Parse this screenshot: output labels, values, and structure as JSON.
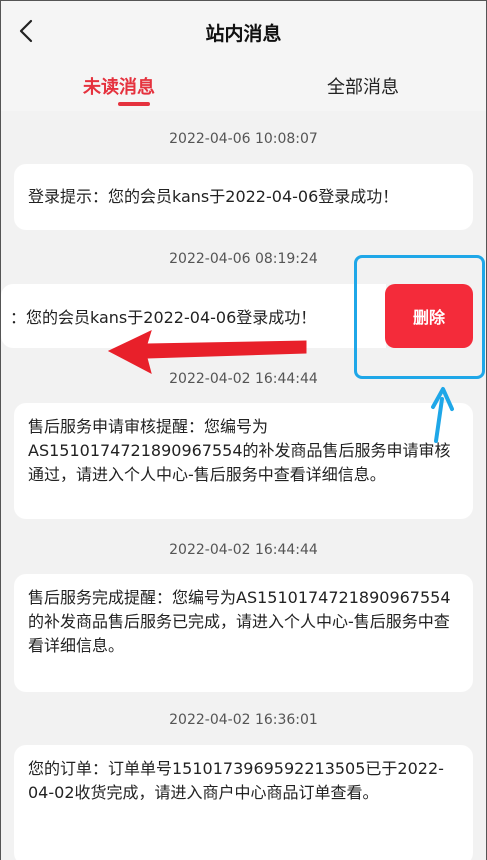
{
  "header": {
    "title": "站内消息",
    "tabs": [
      {
        "label": "未读消息",
        "active": true
      },
      {
        "label": "全部消息",
        "active": false
      }
    ]
  },
  "messages": [
    {
      "time": "2022-04-06 10:08:07",
      "text": "登录提示：您的会员kans于2022-04-06登录成功！"
    },
    {
      "time": "2022-04-06 08:19:24",
      "text": "：您的会员kans于2022-04-06登录成功！",
      "swiped": true,
      "action_label": "删除"
    },
    {
      "time": "2022-04-02 16:44:44",
      "text": "售后服务申请审核提醒：您编号为AS1510174721890967554的补发商品售后服务申请审核通过，请进入个人中心-售后服务中查看详细信息。"
    },
    {
      "time": "2022-04-02 16:44:44",
      "text": "售后服务完成提醒：您编号为AS1510174721890967554的补发商品售后服务已完成，请进入个人中心-售后服务中查看详细信息。"
    },
    {
      "time": "2022-04-02 16:36:01",
      "text": "您的订单：订单单号1510173969592213505已于2022-04-02收货完成，请进入商户中心商品订单查看。"
    }
  ],
  "colors": {
    "accent": "#e5323e",
    "delete": "#f42b3a",
    "annotation_red": "#e8202a",
    "annotation_blue": "#1fa7e8"
  },
  "icons": {
    "back": "chevron-left-icon"
  }
}
